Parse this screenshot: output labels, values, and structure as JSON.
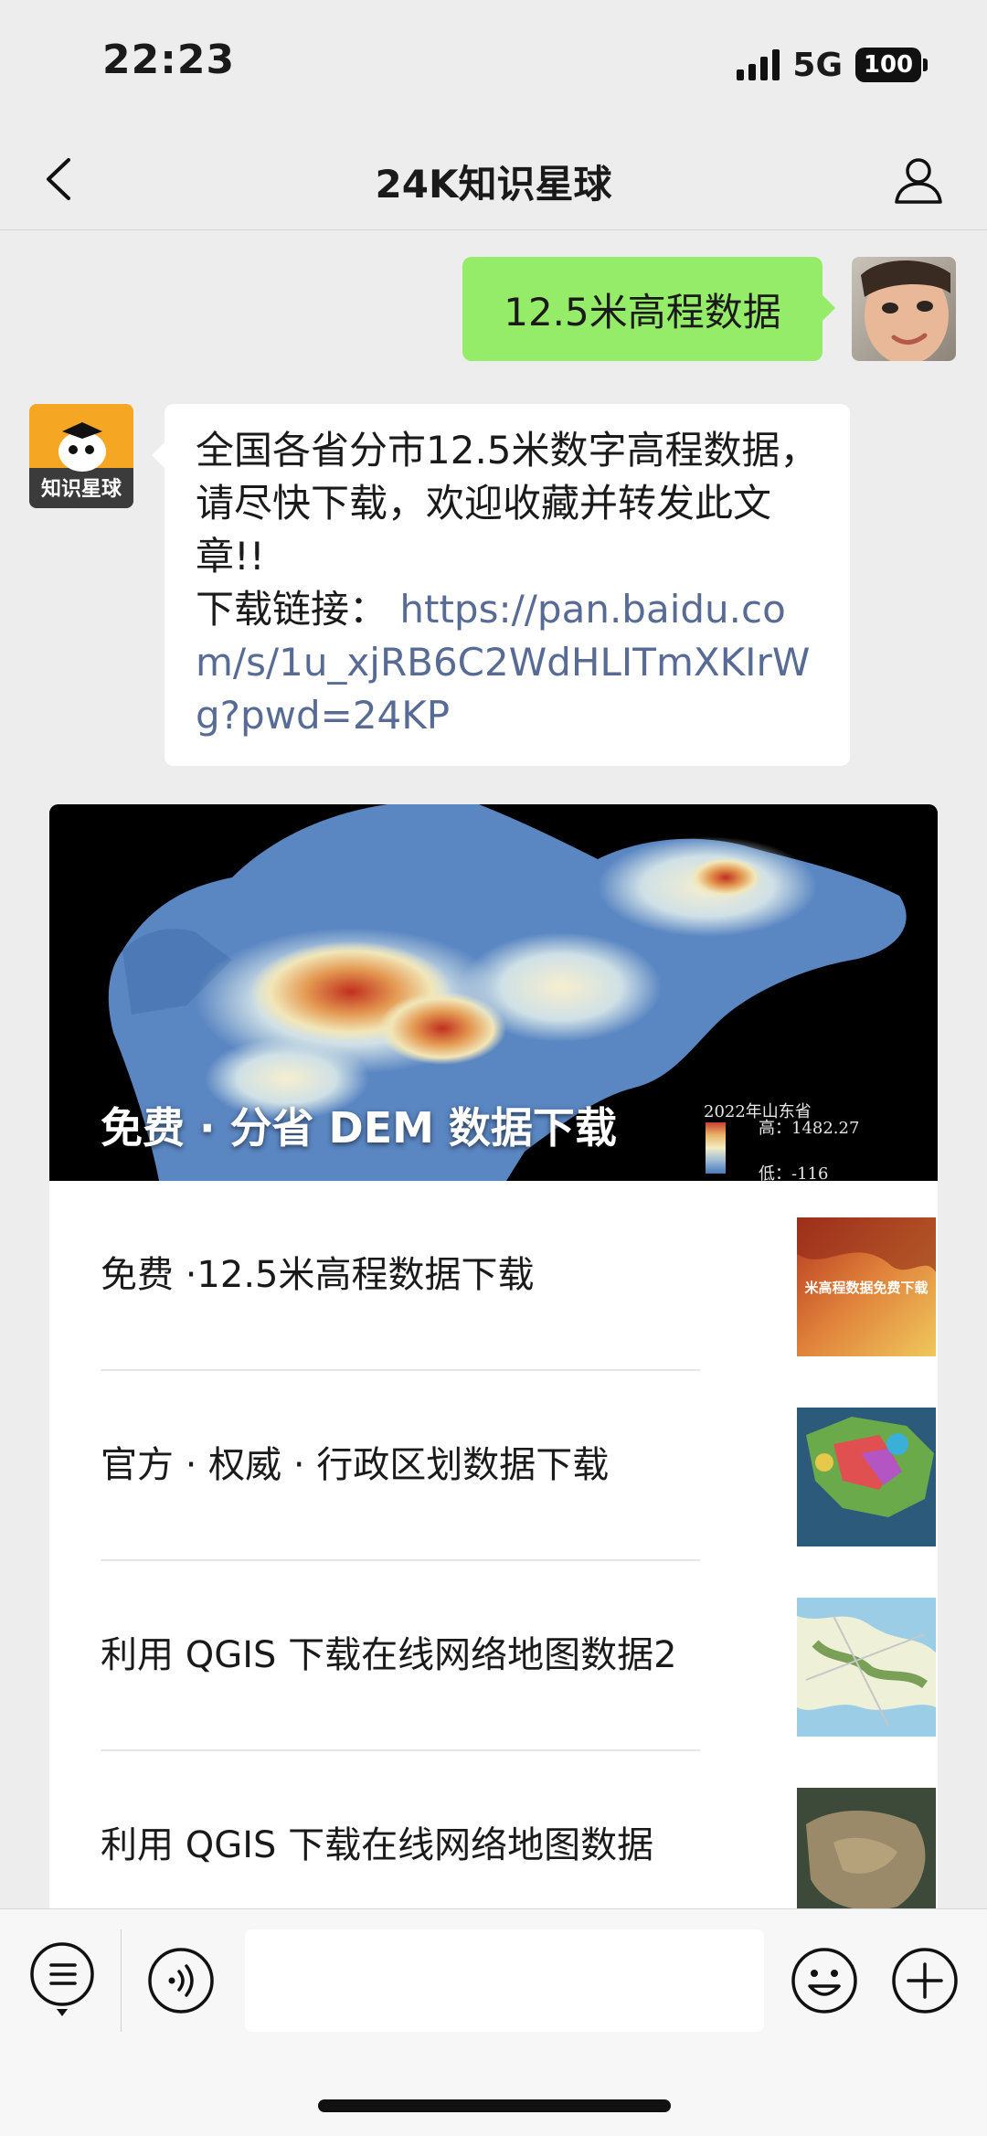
{
  "status_bar": {
    "time": "22:23",
    "network": "5G",
    "battery": "100"
  },
  "nav": {
    "title": "24K知识星球",
    "back_icon": "chevron-left-icon",
    "profile_icon": "person-icon"
  },
  "messages": {
    "outgoing": {
      "text": "12.5米高程数据"
    },
    "incoming": {
      "avatar_text": "知识星球",
      "line1": "全国各省分市12.5米数字高程数据，请尽快下载，欢迎收藏并转发此文章!!",
      "link_label": "下载链接：",
      "link_url": "https://pan.baidu.com/s/1u_xjRB6C2WdHLITmXKIrWg?pwd=24KP"
    }
  },
  "article_card": {
    "cover_title": "免费 · 分省 DEM 数据下载",
    "legend": {
      "title": "2022年山东省",
      "high": "高：1482.27",
      "low": "低：-116"
    },
    "items": [
      {
        "title": "免费 ·12.5米高程数据下载",
        "thumb_text": "米高程数据免费下载"
      },
      {
        "title": "官方 · 权威 · 行政区划数据下载"
      },
      {
        "title": "利用 QGIS 下载在线网络地图数据2"
      },
      {
        "title": "利用 QGIS 下载在线网络地图数据"
      }
    ]
  },
  "bottom_bar": {
    "menu_icon": "list-menu-icon",
    "voice_icon": "voice-icon",
    "emoji_icon": "emoji-icon",
    "add_icon": "plus-icon",
    "input_value": ""
  },
  "colors": {
    "background": "#ededed",
    "outgoing_bubble": "#95ec69",
    "link": "#576b95"
  }
}
